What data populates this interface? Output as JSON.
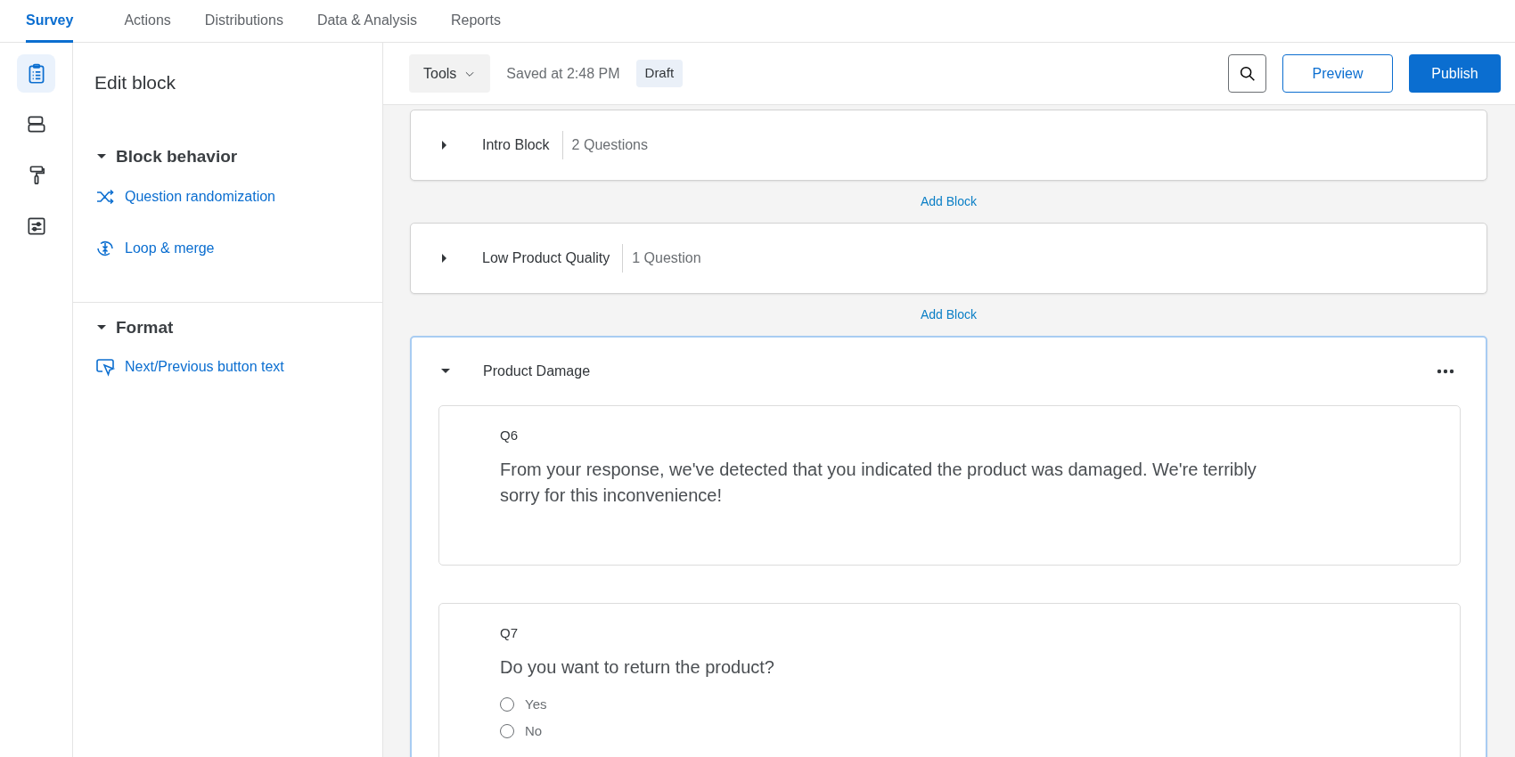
{
  "nav_tabs": [
    {
      "label": "Survey",
      "selected": true
    },
    {
      "label": "Actions",
      "selected": false
    },
    {
      "label": "Distributions",
      "selected": false
    },
    {
      "label": "Data & Analysis",
      "selected": false
    },
    {
      "label": "Reports",
      "selected": false
    }
  ],
  "rail": [
    {
      "kind": "clipboard",
      "selected": true
    },
    {
      "kind": "blocks",
      "selected": false
    },
    {
      "kind": "roller",
      "selected": false
    },
    {
      "kind": "sliders",
      "selected": false
    }
  ],
  "panel": {
    "title": "Edit block",
    "sections": [
      {
        "title": "Block behavior",
        "expanded": true,
        "items": [
          {
            "label": "Question randomization",
            "kind": "shuffle"
          },
          {
            "label": "Loop & merge",
            "kind": "loop"
          }
        ]
      },
      {
        "title": "Format",
        "expanded": true,
        "items": [
          {
            "label": "Next/Previous button text",
            "kind": "cursor"
          }
        ]
      }
    ]
  },
  "toolbar": {
    "tools": "Tools",
    "saved": "Saved at 2:48 PM",
    "status": "Draft",
    "preview": "Preview",
    "publish": "Publish"
  },
  "blocks": [
    {
      "title": "Intro Block",
      "count": "2 Questions",
      "expanded": false,
      "selected": false,
      "add_after": "Add Block"
    },
    {
      "title": "Low Product Quality",
      "count": "1 Question",
      "expanded": false,
      "selected": false,
      "add_after": "Add Block"
    },
    {
      "title": "Product Damage",
      "expanded": true,
      "selected": true,
      "questions": [
        {
          "number": "Q6",
          "kind": "text",
          "text": "From your response, we've detected that you indicated the product was damaged. We're terribly sorry for this inconvenience!"
        },
        {
          "number": "Q7",
          "kind": "choice",
          "text": "Do you want to return the product?",
          "choices": [
            {
              "label": "Yes",
              "selected": false
            },
            {
              "label": "No",
              "selected": false
            }
          ]
        }
      ]
    }
  ]
}
